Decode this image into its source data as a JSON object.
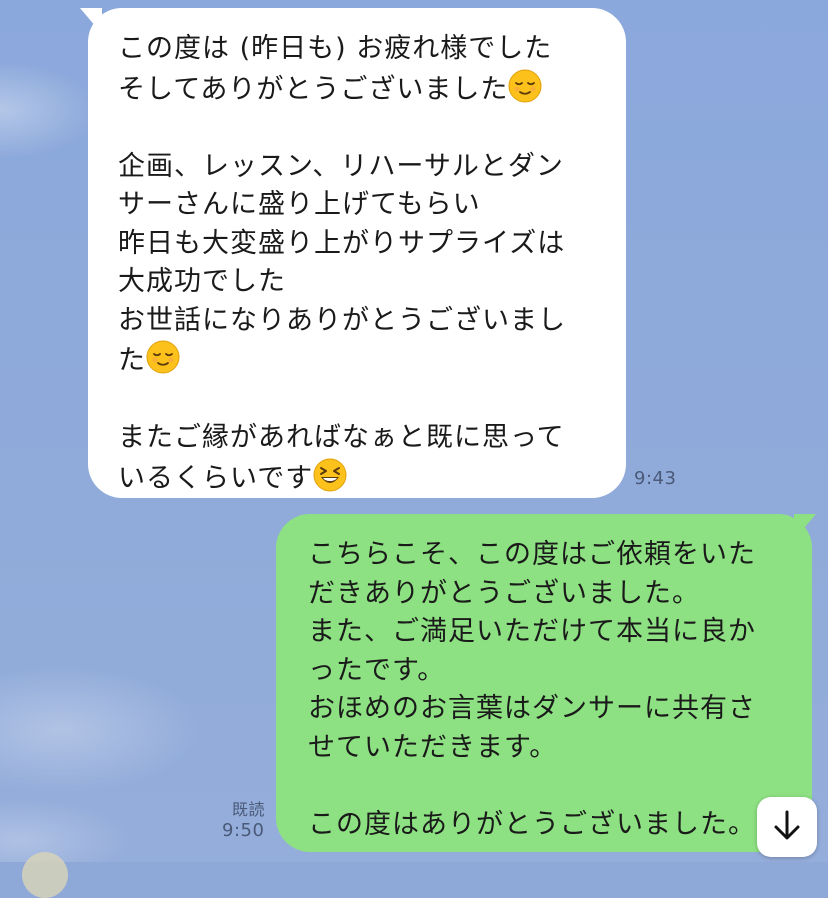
{
  "chat": {
    "incoming": {
      "lines": [
        "この度は (昨日も) お疲れ様でした",
        "そしてありがとうございました",
        "",
        "企画、レッスン、リハーサルとダン",
        "サーさんに盛り上げてもらい",
        "昨日も大変盛り上がりサプライズは",
        "大成功でした",
        "お世話になりありがとうございまし",
        "た",
        "",
        "またご縁があればなぁと既に思って",
        "いるくらいです"
      ],
      "emojis": [
        "relieved-face",
        "relieved-face",
        "grinning-squinting-face"
      ],
      "time": "9:43"
    },
    "outgoing": {
      "lines": [
        "こちらこそ、この度はご依頼をいた",
        "だきありがとうございました。",
        "また、ご満足いただけて本当に良か",
        "ったです。",
        "おほめのお言葉はダンサーに共有さ",
        "せていただきます。",
        "",
        "この度はありがとうございました。"
      ],
      "read_label": "既読",
      "time": "9:50"
    },
    "scroll_down_icon": "arrow-down-icon"
  },
  "colors": {
    "background": "#8ea9d8",
    "incoming_bubble": "#ffffff",
    "outgoing_bubble": "#8de182",
    "meta_text": "#4a5a78"
  }
}
